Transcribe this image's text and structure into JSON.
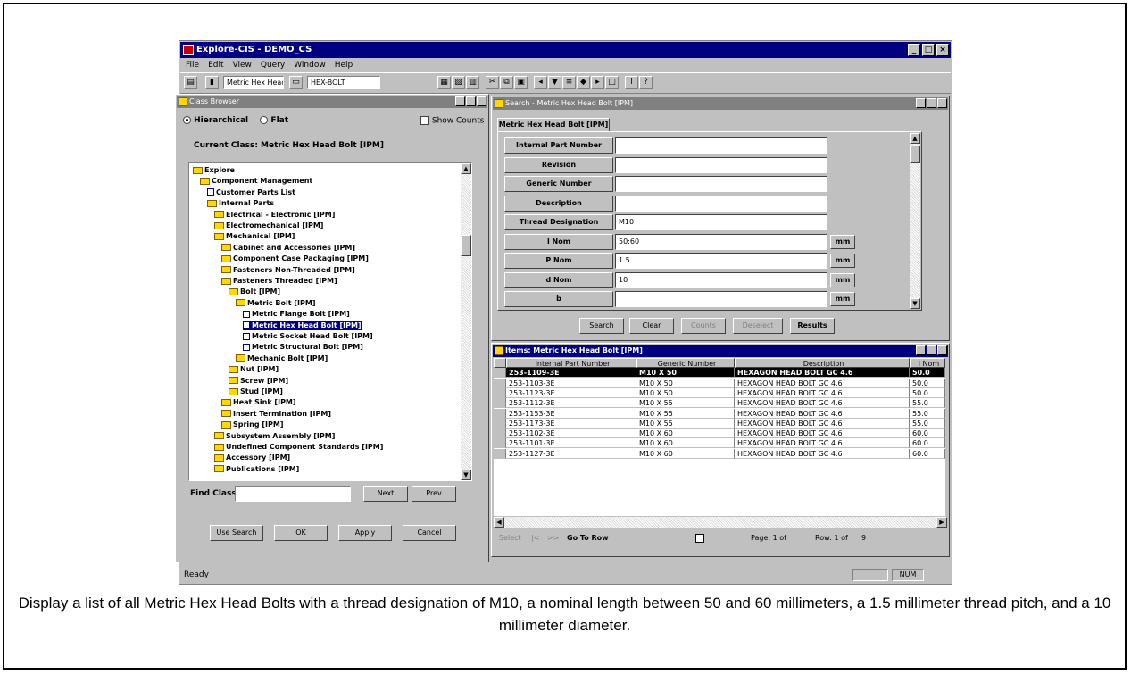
{
  "app": {
    "title": "Explore-CIS - DEMO_CS"
  },
  "menu": [
    "File",
    "Edit",
    "View",
    "Query",
    "Window",
    "Help"
  ],
  "toolbar": {
    "combo1": "Metric Hex Head",
    "combo2": "HEX-BOLT"
  },
  "class_browser": {
    "title": "Class Browser",
    "view_hierarchical": "Hierarchical",
    "view_flat": "Flat",
    "show_counts": "Show Counts",
    "current_class": "Current Class: Metric Hex Head Bolt [IPM]",
    "tree": [
      {
        "label": "Explore",
        "depth": 0
      },
      {
        "label": "Component Management",
        "depth": 1
      },
      {
        "label": "Customer Parts List",
        "depth": 2
      },
      {
        "label": "Internal Parts",
        "depth": 2
      },
      {
        "label": "Electrical - Electronic [IPM]",
        "depth": 3
      },
      {
        "label": "Electromechanical [IPM]",
        "depth": 3
      },
      {
        "label": "Mechanical [IPM]",
        "depth": 3
      },
      {
        "label": "Cabinet and Accessories [IPM]",
        "depth": 4
      },
      {
        "label": "Component Case Packaging [IPM]",
        "depth": 4
      },
      {
        "label": "Fasteners Non-Threaded [IPM]",
        "depth": 4
      },
      {
        "label": "Fasteners Threaded [IPM]",
        "depth": 4
      },
      {
        "label": "Bolt [IPM]",
        "depth": 5
      },
      {
        "label": "Metric Bolt [IPM]",
        "depth": 6
      },
      {
        "label": "Metric Flange Bolt [IPM]",
        "depth": 7
      },
      {
        "label": "Metric Hex Head Bolt [IPM]",
        "depth": 7,
        "selected": true
      },
      {
        "label": "Metric Socket Head Bolt [IPM]",
        "depth": 7
      },
      {
        "label": "Metric Structural Bolt [IPM]",
        "depth": 7
      },
      {
        "label": "Mechanic Bolt [IPM]",
        "depth": 6
      },
      {
        "label": "Nut [IPM]",
        "depth": 5
      },
      {
        "label": "Screw [IPM]",
        "depth": 5
      },
      {
        "label": "Stud [IPM]",
        "depth": 5
      },
      {
        "label": "Heat Sink [IPM]",
        "depth": 4
      },
      {
        "label": "Insert Termination [IPM]",
        "depth": 4
      },
      {
        "label": "Spring [IPM]",
        "depth": 4
      },
      {
        "label": "Subsystem Assembly [IPM]",
        "depth": 3
      },
      {
        "label": "Undefined Component Standards [IPM]",
        "depth": 3
      },
      {
        "label": "Accessory [IPM]",
        "depth": 3
      },
      {
        "label": "Publications [IPM]",
        "depth": 3
      }
    ],
    "find_label": "Find Class",
    "find_value": "",
    "next_btn": "Next",
    "prev_btn": "Prev",
    "buttons": [
      "Use Search",
      "OK",
      "Apply",
      "Cancel"
    ]
  },
  "search": {
    "title": "Search - Metric Hex Head Bolt [IPM]",
    "tab": "Metric Hex Head Bolt [IPM]",
    "fields": [
      {
        "label": "Internal Part Number",
        "value": "",
        "unit": ""
      },
      {
        "label": "Revision",
        "value": "",
        "unit": ""
      },
      {
        "label": "Generic Number",
        "value": "",
        "unit": ""
      },
      {
        "label": "Description",
        "value": "",
        "unit": ""
      },
      {
        "label": "Thread Designation",
        "value": "M10",
        "unit": ""
      },
      {
        "label": "l Nom",
        "value": "50:60",
        "unit": "mm"
      },
      {
        "label": "P Nom",
        "value": "1.5",
        "unit": "mm"
      },
      {
        "label": "d Nom",
        "value": "10",
        "unit": "mm"
      },
      {
        "label": "b",
        "value": "",
        "unit": "mm"
      }
    ],
    "buttons": [
      {
        "label": "Search",
        "disabled": false,
        "bold": false
      },
      {
        "label": "Clear",
        "disabled": false,
        "bold": false
      },
      {
        "label": "Counts",
        "disabled": true,
        "bold": false
      },
      {
        "label": "Deselect",
        "disabled": true,
        "bold": false
      },
      {
        "label": "Results",
        "disabled": false,
        "bold": true
      }
    ]
  },
  "results": {
    "title": "Items: Metric Hex Head Bolt [IPM]",
    "columns": [
      "Internal Part Number",
      "Generic Number",
      "Description",
      "l Nom"
    ],
    "rows": [
      [
        "253-1109-3E",
        "M10 X 50",
        "HEXAGON HEAD BOLT  GC 4.6",
        "50.0"
      ],
      [
        "253-1103-3E",
        "M10 X 50",
        "HEXAGON HEAD BOLT  GC 4.6",
        "50.0"
      ],
      [
        "253-1123-3E",
        "M10 X 50",
        "HEXAGON HEAD BOLT  GC 4.6",
        "50.0"
      ],
      [
        "253-1112-3E",
        "M10 X 55",
        "HEXAGON HEAD BOLT  GC 4.6",
        "55.0"
      ],
      [
        "253-1153-3E",
        "M10 X 55",
        "HEXAGON HEAD BOLT  GC 4.6",
        "55.0"
      ],
      [
        "253-1173-3E",
        "M10 X 55",
        "HEXAGON HEAD BOLT  GC 4.6",
        "55.0"
      ],
      [
        "253-1102-3E",
        "M10 X 60",
        "HEXAGON HEAD BOLT  GC 4.6",
        "60.0"
      ],
      [
        "253-1101-3E",
        "M10 X 60",
        "HEXAGON HEAD BOLT  GC 4.6",
        "60.0"
      ],
      [
        "253-1127-3E",
        "M10 X 60",
        "HEXAGON HEAD BOLT  GC 4.6",
        "60.0"
      ]
    ],
    "nav": {
      "select": "Select",
      "goto": "Go To Row",
      "page": "Page: 1 of",
      "row": "Row: 1 of",
      "row_total": "9"
    }
  },
  "status": {
    "text": "Ready",
    "mode": "NUM"
  },
  "caption": "Display a list of all Metric Hex Head Bolts with a thread designation of M10, a nominal length between 50 and 60 millimeters, a 1.5 millimeter thread pitch, and a 10 millimeter diameter."
}
